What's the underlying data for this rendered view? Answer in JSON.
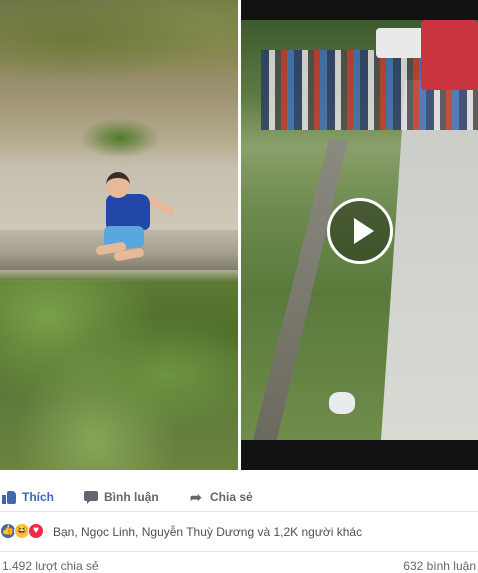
{
  "media": {
    "video_state": "paused"
  },
  "actions": {
    "like_label": "Thích",
    "comment_label": "Bình luận",
    "share_label": "Chia sẻ"
  },
  "reactions": {
    "icons": [
      "like-icon",
      "haha-icon",
      "love-icon"
    ],
    "summary": "Bạn, Ngọc Linh, Nguyễn Thuỳ Dương và 1,2K người khác"
  },
  "stats": {
    "shares": "1.492 lượt chia sẻ",
    "comments": "632 bình luận"
  },
  "colors": {
    "like_blue": "#4267b2",
    "love_red": "#f0284a",
    "haha_yellow": "#f7c44a",
    "meta_gray": "#606770"
  }
}
